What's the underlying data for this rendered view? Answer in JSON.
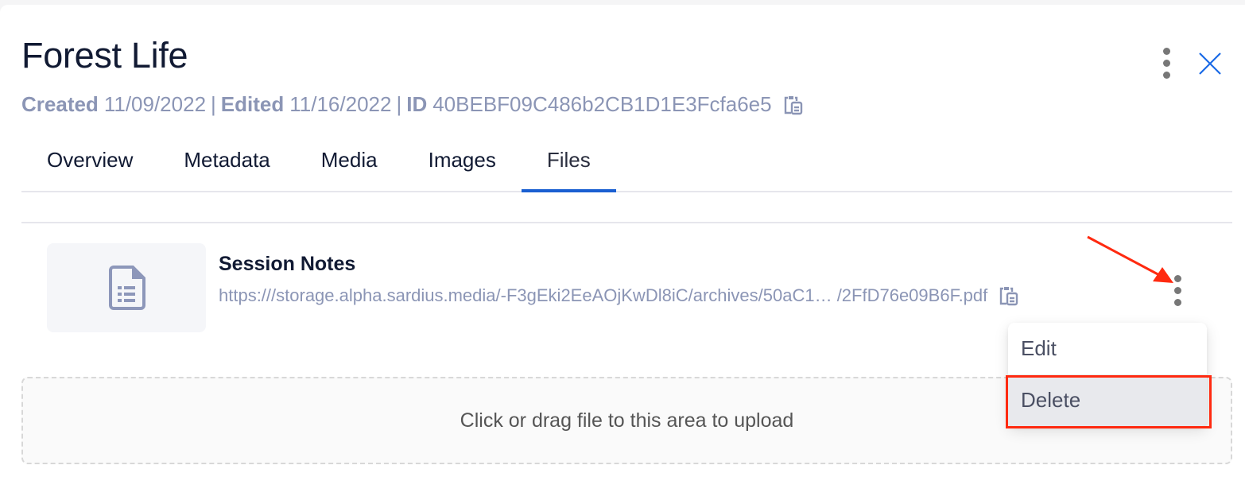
{
  "header": {
    "title": "Forest Life",
    "meta": {
      "created_label": "Created",
      "created_value": "11/09/2022",
      "edited_label": "Edited",
      "edited_value": "11/16/2022",
      "id_label": "ID",
      "id_value": "40BEBF09C486b2CB1D1E3Fcfa6e5",
      "separator": "|"
    },
    "actions": {
      "more_icon": "kebab-vertical-icon",
      "close_icon": "close-x-icon"
    }
  },
  "tabs": [
    {
      "label": "Overview",
      "active": false
    },
    {
      "label": "Metadata",
      "active": false
    },
    {
      "label": "Media",
      "active": false
    },
    {
      "label": "Images",
      "active": false
    },
    {
      "label": "Files",
      "active": true
    }
  ],
  "files": [
    {
      "name": "Session Notes",
      "url": "https:///storage.alpha.sardius.media/-F3gEki2EeAOjKwDl8iC/archives/50aC1… /2FfD76e09B6F.pdf",
      "thumb_icon": "document-list-icon"
    }
  ],
  "context_menu": {
    "items": [
      {
        "label": "Edit",
        "hovered": false
      },
      {
        "label": "Delete",
        "hovered": true
      }
    ]
  },
  "upload": {
    "text": "Click or drag file to this area to upload"
  },
  "colors": {
    "accent": "#1a5fd1",
    "title": "#111a33",
    "muted": "#8b95b5",
    "annotation": "#ff2a10"
  }
}
